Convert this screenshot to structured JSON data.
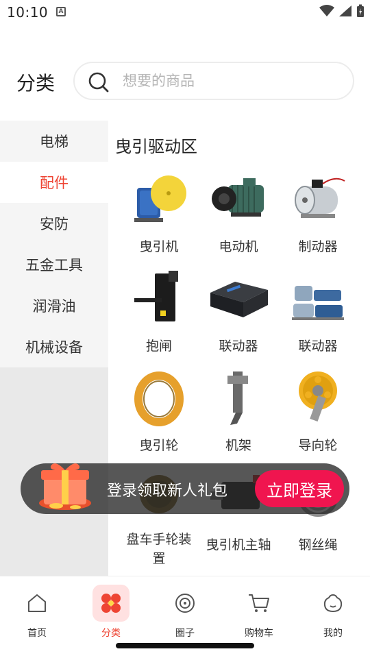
{
  "status_bar": {
    "time": "10:10",
    "notification_letter": "A"
  },
  "header": {
    "title": "分类"
  },
  "search": {
    "placeholder": "想要的商品",
    "value": ""
  },
  "sidebar": {
    "items": [
      {
        "label": "电梯",
        "active": false
      },
      {
        "label": "配件",
        "active": true
      },
      {
        "label": "安防",
        "active": false
      },
      {
        "label": "五金工具",
        "active": false
      },
      {
        "label": "润滑油",
        "active": false
      },
      {
        "label": "机械设备",
        "active": false
      }
    ]
  },
  "content": {
    "section_title": "曳引驱动区",
    "products": [
      {
        "label": "曳引机",
        "icon": "traction-machine-icon"
      },
      {
        "label": "电动机",
        "icon": "motor-icon"
      },
      {
        "label": "制动器",
        "icon": "brake-icon"
      },
      {
        "label": "抱闸",
        "icon": "holding-brake-icon"
      },
      {
        "label": "联动器",
        "icon": "controller-box-icon"
      },
      {
        "label": "联动器",
        "icon": "linkage-motors-icon"
      },
      {
        "label": "曳引轮",
        "icon": "traction-sheave-icon"
      },
      {
        "label": "机架",
        "icon": "frame-icon"
      },
      {
        "label": "导向轮",
        "icon": "guide-wheel-icon"
      },
      {
        "label": "盘车手轮装置",
        "icon": "handwheel-icon"
      },
      {
        "label": "曳引机主轴",
        "icon": "spindle-icon"
      },
      {
        "label": "钢丝绳",
        "icon": "wire-rope-icon"
      }
    ]
  },
  "login_banner": {
    "text": "登录领取新人礼包",
    "button_label": "立即登录"
  },
  "tab_bar": {
    "tabs": [
      {
        "label": "首页",
        "active": false
      },
      {
        "label": "分类",
        "active": true
      },
      {
        "label": "圈子",
        "active": false
      },
      {
        "label": "购物车",
        "active": false
      },
      {
        "label": "我的",
        "active": false
      }
    ]
  },
  "colors": {
    "accent": "#ee4433",
    "login_button": "#f0154f",
    "sidebar_bg": "#f5f5f5"
  }
}
